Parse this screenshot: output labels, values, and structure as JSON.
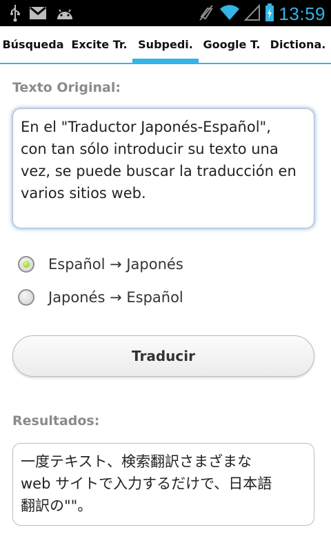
{
  "status_bar": {
    "time": "13:59",
    "left_icons": [
      "usb-icon",
      "gmail-icon",
      "android-icon"
    ],
    "right_icons": [
      "mute-icon",
      "wifi-icon",
      "signal-icon",
      "battery-icon"
    ],
    "accent": "#33b5e5"
  },
  "tabs": [
    {
      "label": "Búsqueda",
      "active": false
    },
    {
      "label": "Excite Tr.",
      "active": false
    },
    {
      "label": "Subpedi.",
      "active": true
    },
    {
      "label": "Google T.",
      "active": false
    },
    {
      "label": "Dictiona.",
      "active": false
    }
  ],
  "original": {
    "label": "Texto Original:",
    "text": "En el \"Traductor Japonés-Español\",\ncon tan sólo introducir su texto una\nvez, se puede buscar la traducción en\nvarios sitios web."
  },
  "direction": {
    "options": [
      {
        "label": "Español → Japonés",
        "checked": true
      },
      {
        "label": "Japonés → Español",
        "checked": false
      }
    ]
  },
  "translate_button": {
    "label": "Traducir"
  },
  "results": {
    "label": "Resultados:",
    "text": "一度テキスト、検索翻訳さまざまな\nweb サイトで入力するだけで、日本語\n翻訳の\"\"。"
  }
}
